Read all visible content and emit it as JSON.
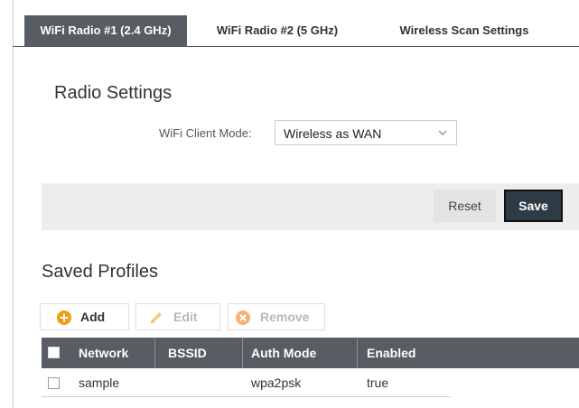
{
  "tabs": [
    {
      "label": "WiFi Radio #1 (2.4 GHz)",
      "active": true
    },
    {
      "label": "WiFi Radio #2 (5 GHz)",
      "active": false
    },
    {
      "label": "Wireless Scan Settings",
      "active": false
    }
  ],
  "radio_settings": {
    "title": "Radio Settings",
    "client_mode_label": "WiFi Client Mode:",
    "client_mode_value": "Wireless as WAN"
  },
  "actions": {
    "reset_label": "Reset",
    "save_label": "Save"
  },
  "saved_profiles": {
    "title": "Saved Profiles",
    "toolbar": {
      "add": {
        "label": "Add",
        "icon": "plus-circle-icon",
        "enabled": true
      },
      "edit": {
        "label": "Edit",
        "icon": "pencil-icon",
        "enabled": false
      },
      "remove": {
        "label": "Remove",
        "icon": "x-circle-icon",
        "enabled": false
      }
    },
    "columns": [
      "Network",
      "BSSID",
      "Auth Mode",
      "Enabled"
    ],
    "rows": [
      {
        "network": "sample",
        "bssid": "",
        "auth_mode": "wpa2psk",
        "enabled": "true"
      }
    ]
  },
  "colors": {
    "tab_active_bg": "#575d63",
    "header_bg": "#575d63",
    "save_bg": "#2f3b44",
    "add_icon": "#f39c12",
    "remove_icon": "#f3b27a",
    "edit_icon": "#f5c986"
  }
}
